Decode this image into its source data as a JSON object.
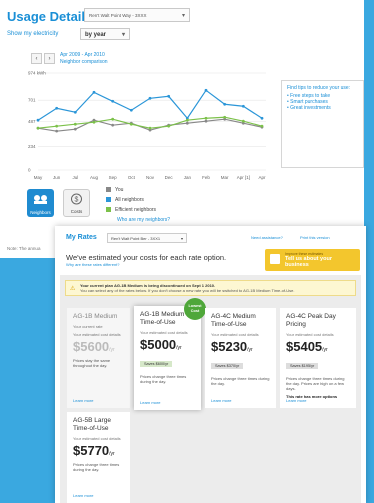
{
  "usage": {
    "title": "Usage Details",
    "address": "Ren't Walt Point Way - 3XXX",
    "show_label": "Show my electricity",
    "period": "by year",
    "range": "Apr 2009 - Apr 2010",
    "comparison_link": "Neighbor comparison",
    "tips": {
      "title": "Find tips to reduce your use:",
      "items": [
        "• Free steps to take",
        "• Smart purchases",
        "• Great investments"
      ]
    },
    "views": {
      "neighbors": "Neighbors",
      "costs": "Costs"
    },
    "legend": {
      "you": "You",
      "all": "All neighbors",
      "efficient": "Efficient neighbors",
      "link": "Who are my neighbors?"
    },
    "note": "Note: The annua"
  },
  "chart_data": {
    "type": "line",
    "categories": [
      "May",
      "Jun",
      "Jul",
      "Aug",
      "Sep",
      "Oct",
      "Nov",
      "Dec",
      "Jan",
      "Feb",
      "Mar",
      "Apr [1]",
      "Apr"
    ],
    "y_ticks": [
      "974 kWh",
      "701",
      "487",
      "234",
      "0"
    ],
    "ylim": [
      0,
      974
    ],
    "series": [
      {
        "name": "You",
        "color": "#888888",
        "values": [
          420,
          390,
          410,
          500,
          450,
          470,
          400,
          450,
          470,
          490,
          510,
          470,
          430
        ]
      },
      {
        "name": "All neighbors",
        "color": "#2b96d8",
        "values": [
          500,
          620,
          580,
          780,
          690,
          600,
          720,
          740,
          520,
          800,
          660,
          640,
          520
        ]
      },
      {
        "name": "Efficient neighbors",
        "color": "#7cc14a",
        "values": [
          420,
          440,
          460,
          480,
          510,
          460,
          420,
          440,
          500,
          520,
          530,
          490,
          440
        ]
      }
    ]
  },
  "rates": {
    "title": "My Rates",
    "address": "Ren't Walt Point Ber - 3XX1",
    "need_help": "Need assistance?",
    "print": "Print this version",
    "estimate_title": "We've estimated your costs for each rate option.",
    "estimate_link": "Why are these rates different?",
    "tell_us_small": "Improve these estimates",
    "tell_us": "Tell us about your business",
    "alert_line1": "Your current plan AG-1B Medium is being discontinued on Sept 1 2010.",
    "alert_line2": "You can select any of the rates below. If you don't choose a new rate you will be switched to AG-1B Medium Time-of-Use.",
    "badge": "Lowest Cost",
    "cards": [
      {
        "name": "AG-1B Medium",
        "sub": "Your current rate",
        "est": "Your estimated cost details",
        "cost": "$5600",
        "unit": "/yr",
        "save": "",
        "desc": "Prices stay the same throughout the day.",
        "extra": "",
        "learn": "Learn more"
      },
      {
        "name": "AG-1B Medium Time-of-Use",
        "sub": "",
        "est": "Your estimated cost details",
        "cost": "$5000",
        "unit": "/yr",
        "save": "Saves $600/yr",
        "desc": "Prices change three times during the day.",
        "extra": "",
        "learn": "Learn more"
      },
      {
        "name": "AG-4C Medium Time-of-Use",
        "sub": "",
        "est": "Your estimated cost details",
        "cost": "$5230",
        "unit": "/yr",
        "save": "Saves $370/yr",
        "desc": "Prices change three times during the day.",
        "extra": "",
        "learn": "Learn more"
      },
      {
        "name": "AG-4C Peak Day Pricing",
        "sub": "",
        "est": "Your estimated cost details",
        "cost": "$5405",
        "unit": "/yr",
        "save": "Saves $195/yr",
        "desc": "Prices change three times during the day. Prices are high on a few days.",
        "extra": "This rate has more options",
        "learn": "Learn more"
      },
      {
        "name": "AG-5B Large Time-of-Use",
        "sub": "",
        "est": "Your estimated cost details",
        "cost": "$5770",
        "unit": "/yr",
        "save": "",
        "desc": "Prices change three times during the day.",
        "extra": "",
        "learn": "Learn more"
      }
    ]
  }
}
